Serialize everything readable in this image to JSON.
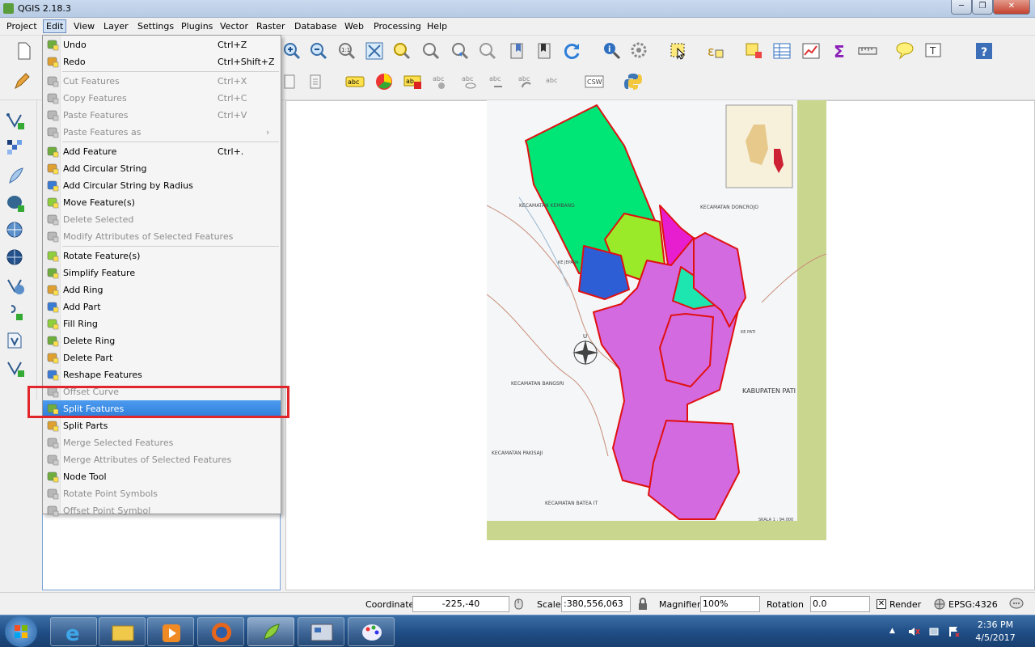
{
  "window": {
    "title": "QGIS 2.18.3"
  },
  "menubar": [
    "Project",
    "Edit",
    "View",
    "Layer",
    "Settings",
    "Plugins",
    "Vector",
    "Raster",
    "Database",
    "Web",
    "Processing",
    "Help"
  ],
  "edit_menu": [
    {
      "label": "Undo",
      "shortcut": "Ctrl+Z",
      "disabled": false
    },
    {
      "label": "Redo",
      "shortcut": "Ctrl+Shift+Z",
      "disabled": false
    },
    {
      "sep": true
    },
    {
      "label": "Cut Features",
      "shortcut": "Ctrl+X",
      "disabled": true
    },
    {
      "label": "Copy Features",
      "shortcut": "Ctrl+C",
      "disabled": true
    },
    {
      "label": "Paste Features",
      "shortcut": "Ctrl+V",
      "disabled": true
    },
    {
      "label": "Paste Features as",
      "shortcut": "",
      "disabled": true,
      "submenu": true
    },
    {
      "sep": true
    },
    {
      "label": "Add Feature",
      "shortcut": "Ctrl+.",
      "disabled": false
    },
    {
      "label": "Add Circular String",
      "shortcut": "",
      "disabled": false
    },
    {
      "label": "Add Circular String by Radius",
      "shortcut": "",
      "disabled": false
    },
    {
      "label": "Move Feature(s)",
      "shortcut": "",
      "disabled": false
    },
    {
      "label": "Delete Selected",
      "shortcut": "",
      "disabled": true
    },
    {
      "label": "Modify Attributes of Selected Features",
      "shortcut": "",
      "disabled": true
    },
    {
      "sep": true
    },
    {
      "label": "Rotate Feature(s)",
      "shortcut": "",
      "disabled": false
    },
    {
      "label": "Simplify Feature",
      "shortcut": "",
      "disabled": false
    },
    {
      "label": "Add Ring",
      "shortcut": "",
      "disabled": false
    },
    {
      "label": "Add Part",
      "shortcut": "",
      "disabled": false
    },
    {
      "label": "Fill Ring",
      "shortcut": "",
      "disabled": false
    },
    {
      "label": "Delete Ring",
      "shortcut": "",
      "disabled": false
    },
    {
      "label": "Delete Part",
      "shortcut": "",
      "disabled": false
    },
    {
      "label": "Reshape Features",
      "shortcut": "",
      "disabled": false
    },
    {
      "label": "Offset Curve",
      "shortcut": "",
      "disabled": true
    },
    {
      "label": "Split Features",
      "shortcut": "",
      "disabled": false,
      "highlighted": true
    },
    {
      "label": "Split Parts",
      "shortcut": "",
      "disabled": false
    },
    {
      "label": "Merge Selected Features",
      "shortcut": "",
      "disabled": true
    },
    {
      "label": "Merge Attributes of Selected Features",
      "shortcut": "",
      "disabled": true
    },
    {
      "label": "Node Tool",
      "shortcut": "",
      "disabled": false
    },
    {
      "label": "Rotate Point Symbols",
      "shortcut": "",
      "disabled": true
    },
    {
      "label": "Offset Point Symbol",
      "shortcut": "",
      "disabled": true
    }
  ],
  "map_labels": {
    "kembang": "KECAMATAN KEMBANG",
    "doncrojo": "KECAMATAN DONCROJO",
    "kejepara": "KE JEPARA",
    "kepati": "KE PATI",
    "north": "U",
    "bangsri": "KECAMATAN BANGSRI",
    "kabupaten": "KABUPATEN PATI",
    "pakisaji": "KECAMATAN PAKISAJI",
    "batealit": "KECAMATAN BATEA IT",
    "skala": "SKALA 1 : 94.000"
  },
  "statusbar": {
    "coordinate_label": "Coordinate",
    "coordinate_value": "-225,-40",
    "scale_label": "Scale",
    "scale_value": ":380,556,063",
    "magnifier_label": "Magnifier",
    "magnifier_value": "100%",
    "rotation_label": "Rotation",
    "rotation_value": "0.0",
    "render_label": "Render",
    "render_checked": true,
    "crs": "EPSG:4326"
  },
  "taskbar": {
    "time": "2:36 PM",
    "date": "4/5/2017"
  },
  "colors": {
    "highlight": "#3388e6",
    "callout": "#e0262a",
    "polygon_green": "#00e676",
    "polygon_lime": "#9aea2a",
    "polygon_magenta": "#e61ecf",
    "polygon_blue": "#2e5ed6",
    "polygon_teal": "#1de6b0",
    "polygon_violet": "#d46ae0"
  }
}
